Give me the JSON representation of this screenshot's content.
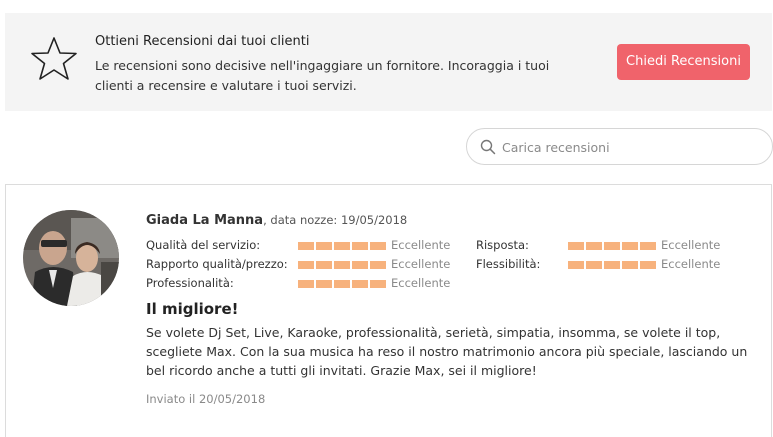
{
  "promo": {
    "icon": "star-outline-icon",
    "title": "Ottieni Recensioni dai tuoi clienti",
    "description": "Le recensioni sono decisive nell'ingaggiare un fornitore. Incoraggia i tuoi clienti a recensire e valutare i tuoi servizi.",
    "button_label": "Chiedi Recensioni"
  },
  "search": {
    "icon": "search-icon",
    "placeholder": "Carica recensioni"
  },
  "review": {
    "avatar": "avatar-photo",
    "name": "Giada La Manna",
    "meta": ", data nozze: 19/05/2018",
    "ratings": [
      {
        "label": "Qualità del servizio:",
        "score": 5,
        "max": 5,
        "text": "Eccellente"
      },
      {
        "label": "Rapporto qualità/prezzo:",
        "score": 5,
        "max": 5,
        "text": "Eccellente"
      },
      {
        "label": "Professionalità:",
        "score": 5,
        "max": 5,
        "text": "Eccellente"
      },
      {
        "label": "Risposta:",
        "score": 5,
        "max": 5,
        "text": "Eccellente"
      },
      {
        "label": "Flessibilità:",
        "score": 5,
        "max": 5,
        "text": "Eccellente"
      }
    ],
    "headline": "Il migliore!",
    "body": "Se volete Dj Set, Live, Karaoke, professionalità, serietà, simpatia, insomma, se volete il top, scegliete Max. Con la sua musica ha reso il nostro matrimonio ancora più speciale, lasciando un bel ricordo anche a tutti gli invitati. Grazie Max, sei il migliore!",
    "sent": "Inviato il 20/05/2018"
  },
  "colors": {
    "accent": "#f0636b",
    "rating_bar": "#f7b27d",
    "panel_bg": "#f4f4f4"
  }
}
